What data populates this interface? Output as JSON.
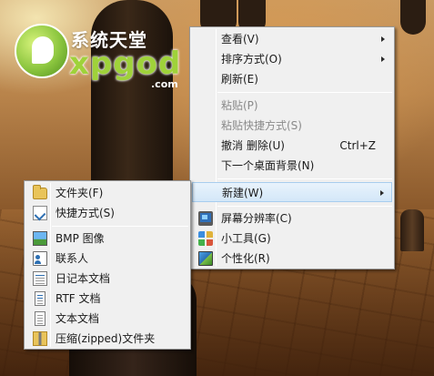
{
  "context_menu": {
    "items": [
      {
        "label": "查看(V)"
      },
      {
        "label": "排序方式(O)"
      },
      {
        "label": "刷新(E)"
      },
      {
        "label": "粘贴(P)"
      },
      {
        "label": "粘贴快捷方式(S)"
      },
      {
        "label": "撤消 删除(U)",
        "shortcut": "Ctrl+Z"
      },
      {
        "label": "下一个桌面背景(N)"
      },
      {
        "label": "新建(W)"
      },
      {
        "label": "屏幕分辨率(C)"
      },
      {
        "label": "小工具(G)"
      },
      {
        "label": "个性化(R)"
      }
    ]
  },
  "new_submenu": {
    "items": [
      {
        "label": "文件夹(F)"
      },
      {
        "label": "快捷方式(S)"
      },
      {
        "label": "BMP 图像"
      },
      {
        "label": "联系人"
      },
      {
        "label": "日记本文档"
      },
      {
        "label": "RTF 文档"
      },
      {
        "label": "文本文档"
      },
      {
        "label": "压缩(zipped)文件夹"
      }
    ]
  },
  "watermark": {
    "cn_text": "系统天堂",
    "en_text": "xpgod",
    "suffix": ".com",
    "color": "#9fd23a"
  },
  "colors": {
    "menu_bg": "#f0f0f0",
    "highlight_border": "#a8cdee",
    "disabled_text": "#8a8a8a"
  }
}
